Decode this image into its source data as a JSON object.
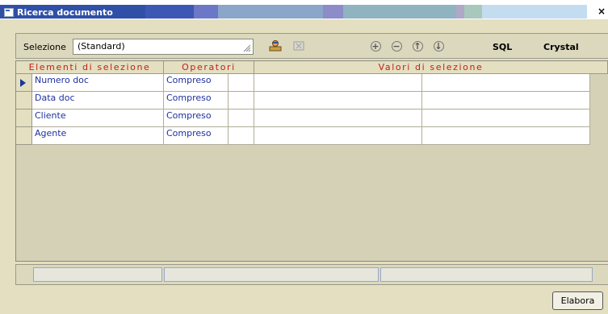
{
  "window": {
    "title": "Ricerca documento",
    "close_glyph": "×"
  },
  "toolbar": {
    "selection_label": "Selezione",
    "selection_value": "(Standard)",
    "sql_label": "SQL",
    "crystal_label": "Crystal",
    "icons": [
      "user-search-icon",
      "clear-icon",
      "add-icon",
      "remove-icon",
      "move-up-icon",
      "move-down-icon"
    ]
  },
  "grid": {
    "headers": {
      "elements": "Elementi di selezione",
      "operators": "Operatori",
      "values": "Valori di selezione"
    },
    "rows": [
      {
        "element": "Numero doc",
        "operator": "Compreso",
        "current": true
      },
      {
        "element": "Data doc",
        "operator": "Compreso",
        "current": false
      },
      {
        "element": "Cliente",
        "operator": "Compreso",
        "current": false
      },
      {
        "element": "Agente",
        "operator": "Compreso",
        "current": false
      }
    ]
  },
  "actions": {
    "run_label": "Elabora"
  }
}
